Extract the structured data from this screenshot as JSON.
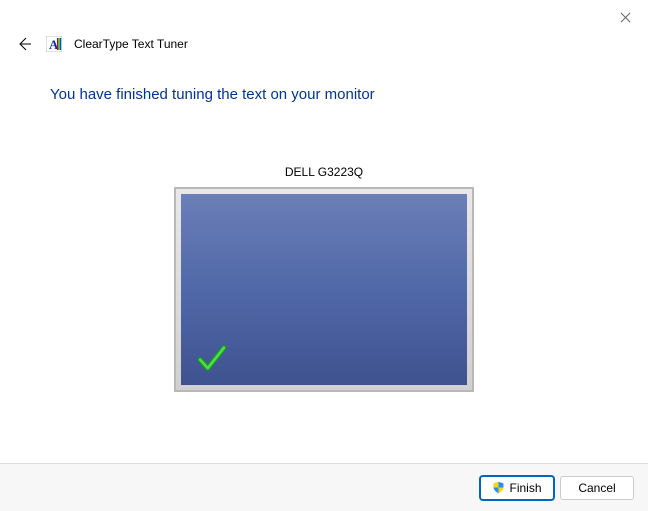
{
  "window": {
    "title": "ClearType Text Tuner"
  },
  "headline": "You have finished tuning the text on your monitor",
  "monitor": {
    "name": "DELL G3223Q"
  },
  "footer": {
    "finish_label": "Finish",
    "cancel_label": "Cancel"
  }
}
